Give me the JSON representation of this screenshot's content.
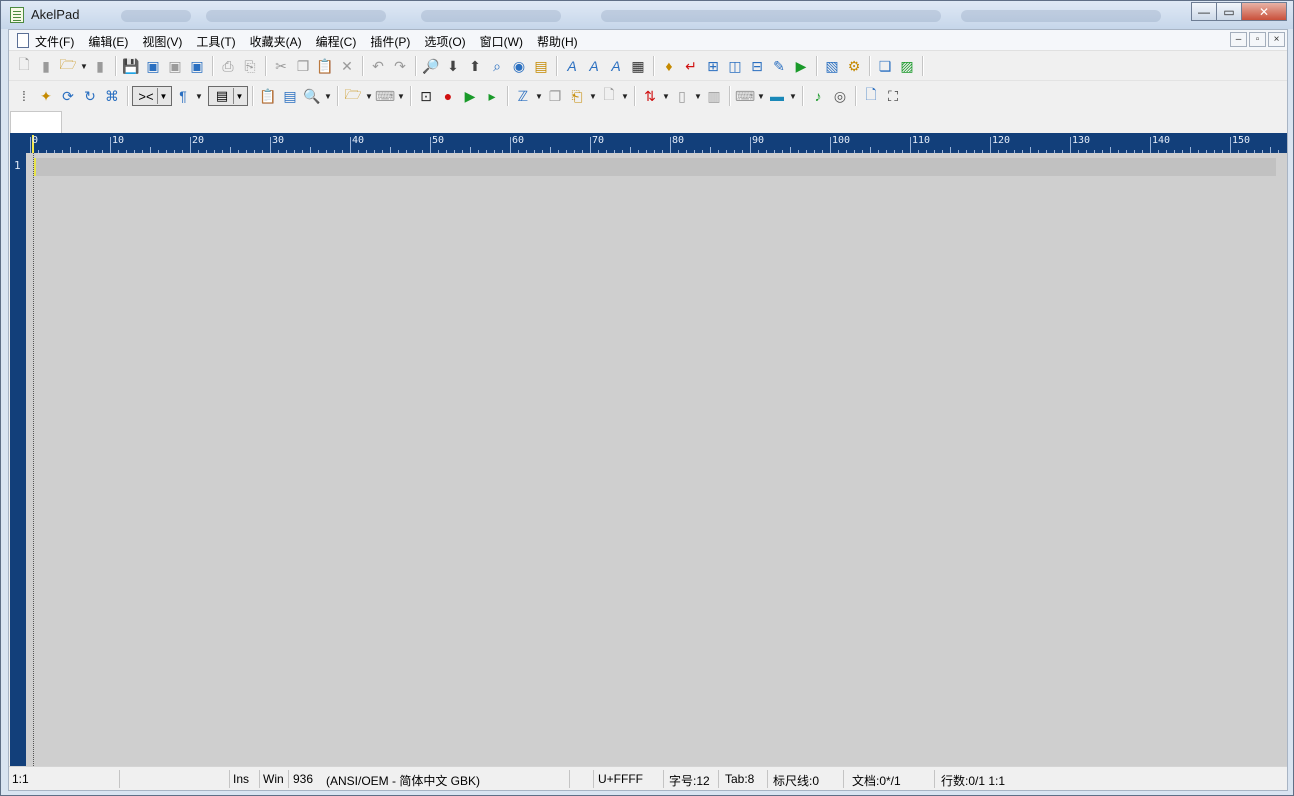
{
  "window": {
    "title": "AkelPad",
    "buttons": {
      "minimize": "—",
      "maximize": "▭",
      "close": "✕"
    }
  },
  "menu": {
    "items": [
      "文件(F)",
      "编辑(E)",
      "视图(V)",
      "工具(T)",
      "收藏夹(A)",
      "编程(C)",
      "插件(P)",
      "选项(O)",
      "窗口(W)",
      "帮助(H)"
    ],
    "mdi_buttons": [
      "–",
      "▫",
      "×"
    ]
  },
  "toolbar1": {
    "icons": [
      "new-file-icon",
      "close-file-icon",
      "open-folder-icon",
      "save-gray-icon",
      "save-icon",
      "save-all-icon",
      "save-as-icon",
      "save-special-icon",
      "print-icon",
      "print-preview-icon",
      "cut-icon",
      "copy-icon",
      "paste-icon",
      "delete-icon",
      "undo-icon",
      "redo-icon",
      "find-icon",
      "find-next-down-icon",
      "find-next-up-icon",
      "replace-icon",
      "go-to-icon",
      "clipboard-icon",
      "font-icon",
      "font-plus-icon",
      "font-minus-icon",
      "color-grid-icon",
      "bookmark-icon",
      "word-wrap-icon",
      "split-window-icon",
      "split-vertical-icon",
      "split-horizontal-icon",
      "tools-icon",
      "run-icon",
      "edit-script-icon",
      "settings-gear-icon",
      "copy-document-icon",
      "notes-icon"
    ]
  },
  "toolbar2": {
    "icons": [
      "code-icon",
      "bulb-icon",
      "macro-record-icon",
      "refresh-code-icon",
      "compare-icon",
      "close-box-icon",
      "pilcrow-icon",
      "view-list-icon",
      "clipboard-list-icon",
      "save-bookmark-icon",
      "zoom-icon",
      "folder-open-icon",
      "keyboard-small-icon",
      "play-box-icon",
      "record-icon",
      "play-icon",
      "play-step-icon",
      "script-icon",
      "templates-icon",
      "paste-special-icon",
      "document-icon",
      "sort-icon",
      "vertical-bar-icon",
      "text-frame-icon",
      "keyboard-icon",
      "panel-icon",
      "music-icon",
      "spiral-icon",
      "page-icon",
      "fullscreen-icon"
    ],
    "box1_label": "><",
    "box2_label": "▤"
  },
  "editor": {
    "line_number": "1",
    "ruler_labels": [
      "0",
      "10",
      "20",
      "30",
      "40",
      "50",
      "60",
      "70",
      "80",
      "90",
      "100",
      "110",
      "120",
      "130",
      "140",
      "150"
    ]
  },
  "status": {
    "position": "1:1",
    "insert_mode": "Ins",
    "newline": "Win",
    "codepage": "936",
    "encoding": "(ANSI/OEM - 简体中文 GBK)",
    "char_code": "U+FFFF",
    "font_size": "字号:12",
    "tab_size": "Tab:8",
    "ruler": "标尺线:0",
    "documents": "文档:0*/1",
    "lines": "行数:0/1 1:1"
  }
}
